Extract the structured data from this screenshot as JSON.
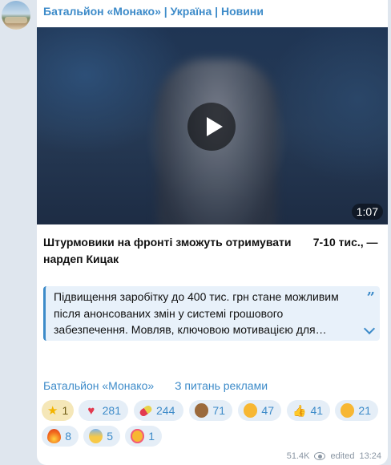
{
  "channel": {
    "name": "Батальйон «Монако» | Україна | Новини"
  },
  "video": {
    "duration": "1:07"
  },
  "post": {
    "title_line1": "Штурмовики на фронті зможуть отримувати       7-10 тис., —",
    "title_line2": "нардеп Кицак",
    "quote": "Підвищення заробітку до 400 тис. грн стане можливим після анонсованих змін у системі грошового забезпечення. Мовляв, ключовою мотивацією для…"
  },
  "links": {
    "channel": "Батальйон «Монако»",
    "about_ads": "З питань реклами"
  },
  "reactions": [
    {
      "icon": "star-icon",
      "count": "1",
      "color": "#f3b400"
    },
    {
      "icon": "heart-fire-icon",
      "count": "281",
      "color": "#e23a4f"
    },
    {
      "icon": "pill-icon",
      "count": "244",
      "color": "#e8d24a"
    },
    {
      "icon": "monkey-icon",
      "count": "71",
      "color": "#9b6a3c"
    },
    {
      "icon": "woozy-face-icon",
      "count": "47",
      "color": "#f7b733"
    },
    {
      "icon": "thumbs-up-icon",
      "count": "41",
      "color": "#f7b733"
    },
    {
      "icon": "thinking-face-icon",
      "count": "21",
      "color": "#f7b733"
    },
    {
      "icon": "fire-icon",
      "count": "8",
      "color": "#f26b1d"
    },
    {
      "icon": "screaming-face-icon",
      "count": "5",
      "color": "#f7c948"
    },
    {
      "icon": "smiling-hearts-face-icon",
      "count": "1",
      "color": "#f7b733"
    }
  ],
  "meta": {
    "views": "51.4K",
    "edited": "edited",
    "time": "13:24"
  }
}
